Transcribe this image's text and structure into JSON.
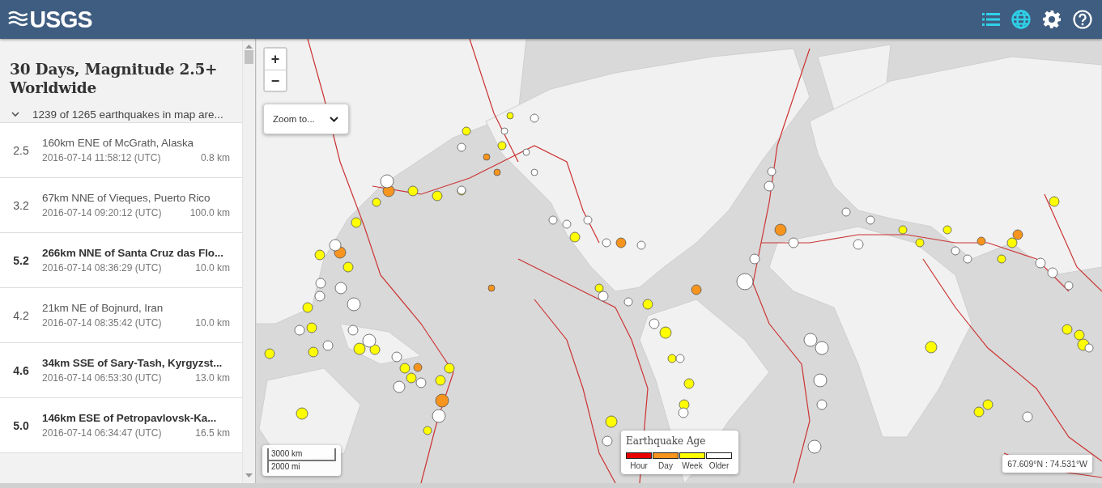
{
  "header": {
    "logo": "USGS",
    "view_toggles": [
      {
        "kind": "list",
        "selected": true
      },
      {
        "kind": "map",
        "selected": true
      }
    ]
  },
  "sidebar": {
    "title": "30 Days, Magnitude 2.5+ Worldwide",
    "filter": "1239 of 1265 earthquakes in map are...",
    "events": [
      {
        "magnitude": "2.5",
        "place": "160km ENE of McGrath, Alaska",
        "time": "2016-07-14 11:58:12 (UTC)",
        "depth": "0.8 km",
        "significant": false
      },
      {
        "magnitude": "3.2",
        "place": "67km NNE of Vieques, Puerto Rico",
        "time": "2016-07-14 09:20:12 (UTC)",
        "depth": "100.0 km",
        "significant": false
      },
      {
        "magnitude": "5.2",
        "place": "266km NNE of Santa Cruz das Flo...",
        "time": "2016-07-14 08:36:29 (UTC)",
        "depth": "10.0 km",
        "significant": true
      },
      {
        "magnitude": "4.2",
        "place": "21km NE of Bojnurd, Iran",
        "time": "2016-07-14 08:35:42 (UTC)",
        "depth": "10.0 km",
        "significant": false
      },
      {
        "magnitude": "4.6",
        "place": "34km SSE of Sary-Tash, Kyrgyzst...",
        "time": "2016-07-14 06:53:30 (UTC)",
        "depth": "13.0 km",
        "significant": true
      },
      {
        "magnitude": "5.0",
        "place": "146km ESE of Petropavlovsk-Ka...",
        "time": "2016-07-14 06:34:47 (UTC)",
        "depth": "16.5 km",
        "significant": true
      }
    ]
  },
  "map": {
    "zoom_in": "+",
    "zoom_out": "−",
    "zoom_to": "Zoom to...",
    "scale": {
      "metric": "3000 km",
      "imperial": "2000 mi"
    },
    "legend": {
      "title": "Earthquake Age",
      "items": [
        {
          "label": "Hour",
          "color": "#e60000"
        },
        {
          "label": "Day",
          "color": "#f7941d"
        },
        {
          "label": "Week",
          "color": "#ffff00"
        },
        {
          "label": "Older",
          "color": "#ffffff"
        }
      ]
    },
    "coordinates": "67.609°N : 74.531°W"
  }
}
